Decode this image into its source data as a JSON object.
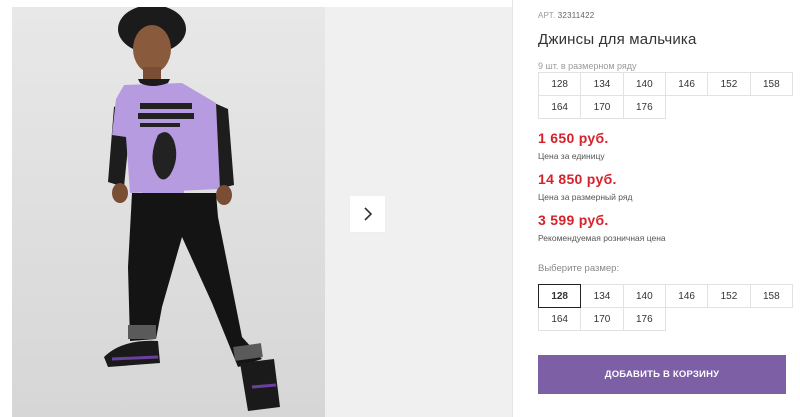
{
  "gallery": {
    "main_image_alt_icon": "boy-model-photo",
    "next_icon": "chevron-right-icon"
  },
  "product": {
    "art_label": "АРТ.",
    "art_number": "32311422",
    "title": "Джинсы для мальчика",
    "series_count": "9 шт. в размерном ряду",
    "series_sizes": [
      "128",
      "134",
      "140",
      "146",
      "152",
      "158",
      "164",
      "170",
      "176"
    ]
  },
  "prices": [
    {
      "value": "1 650 руб.",
      "label": "Цена за единицу"
    },
    {
      "value": "14 850 руб.",
      "label": "Цена за размерный ряд"
    },
    {
      "value": "3 599 руб.",
      "label": "Рекомендуемая розничная цена"
    }
  ],
  "size_select": {
    "label": "Выберите размер:",
    "sizes": [
      "128",
      "134",
      "140",
      "146",
      "152",
      "158",
      "164",
      "170",
      "176"
    ],
    "selected": "128"
  },
  "cart_button": "ДОБАВИТЬ В КОРЗИНУ",
  "colors": {
    "price": "#d6222a",
    "cart_button_bg": "#7d5fa6",
    "shirt": "#b79be0"
  }
}
